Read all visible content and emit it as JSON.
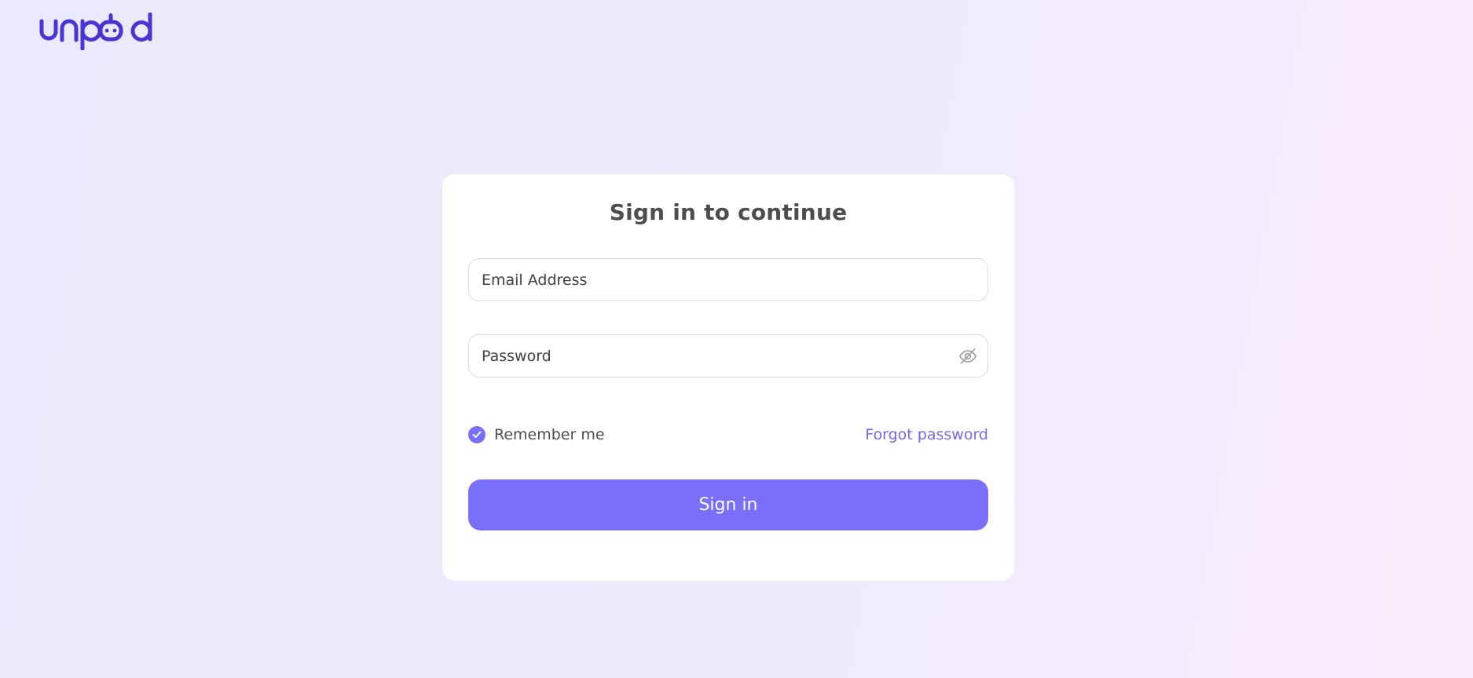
{
  "brand": {
    "logo_text": "unpod",
    "color": "#4a34d4"
  },
  "login": {
    "title": "Sign in to continue",
    "email_placeholder": "Email Address",
    "password_placeholder": "Password",
    "password_toggle_icon": "eye-off-icon",
    "remember_label": "Remember me",
    "remember_checked": true,
    "forgot_label": "Forgot password",
    "submit_label": "Sign in"
  },
  "colors": {
    "accent": "#7a6ffb",
    "link": "#7466f0",
    "title": "#4d4d4f"
  }
}
